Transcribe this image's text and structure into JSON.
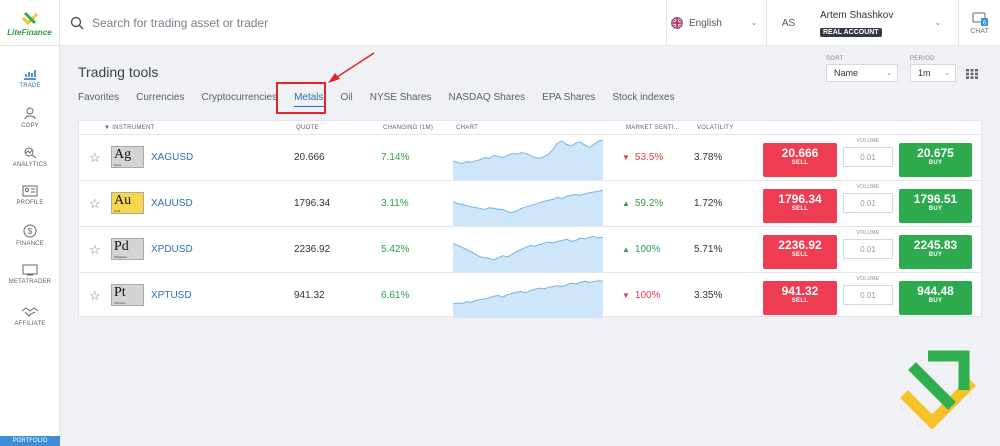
{
  "brand": {
    "name": "LiteFinance"
  },
  "search": {
    "placeholder": "Search for trading asset or trader"
  },
  "language": {
    "selected": "English"
  },
  "user": {
    "initials": "AS",
    "name": "Artem Shashkov",
    "account": "REAL ACCOUNT"
  },
  "chat": {
    "label": "CHAT",
    "badge": "6"
  },
  "sidebar": {
    "items": [
      {
        "label": "TRADE",
        "icon": "chart-icon"
      },
      {
        "label": "COPY",
        "icon": "people-icon"
      },
      {
        "label": "ANALYTICS",
        "icon": "analytics-icon"
      },
      {
        "label": "PROFILE",
        "icon": "profile-card-icon"
      },
      {
        "label": "FINANCE",
        "icon": "dollar-icon"
      },
      {
        "label": "METATRADER",
        "icon": "monitor-icon"
      },
      {
        "label": "AFFILIATE",
        "icon": "handshake-icon"
      }
    ],
    "portfolio": "PORTFOLIO"
  },
  "page": {
    "title": "Trading tools"
  },
  "tabs": [
    "Favorites",
    "Currencies",
    "Cryptocurrencies",
    "Metals",
    "Oil",
    "NYSE Shares",
    "NASDAQ Shares",
    "EPA Shares",
    "Stock indexes"
  ],
  "active_tab": "Metals",
  "controls": {
    "sort_label": "SORT",
    "sort_value": "Name",
    "period_label": "PERIOD",
    "period_value": "1m"
  },
  "table": {
    "headers": {
      "instrument": "INSTRUMENT",
      "quote": "QUOTE",
      "changing": "CHANGING (1M)",
      "chart": "CHART",
      "sentiment": "MARKET SENTI...",
      "volatility": "VOLATILITY"
    },
    "volume_label": "VOLUME",
    "sell_label": "SELL",
    "buy_label": "BUY",
    "rows": [
      {
        "tile": "Ag",
        "tile_name": "Silver",
        "symbol": "XAGUSD",
        "quote": "20.666",
        "change": "7.14%",
        "sentiment": "53.5%",
        "sentiment_dir": "down",
        "volatility": "3.78%",
        "sell": "20.666",
        "buy": "20.675",
        "volume": "0.01",
        "tile_color": "#d4d4d4",
        "spark": [
          0.42,
          0.38,
          0.35,
          0.4,
          0.38,
          0.42,
          0.45,
          0.5,
          0.48,
          0.55,
          0.52,
          0.5,
          0.55,
          0.6,
          0.58,
          0.62,
          0.6,
          0.55,
          0.5,
          0.48,
          0.52,
          0.58,
          0.7,
          0.85,
          0.9,
          0.82,
          0.78,
          0.85,
          0.88,
          0.8,
          0.75,
          0.82,
          0.9,
          0.92
        ]
      },
      {
        "tile": "Au",
        "tile_name": "Gold",
        "symbol": "XAUUSD",
        "quote": "1796.34",
        "change": "3.11%",
        "sentiment": "59.2%",
        "sentiment_dir": "up",
        "volatility": "1.72%",
        "sell": "1796.34",
        "buy": "1796.51",
        "volume": "0.01",
        "tile_color": "#f6d64a",
        "spark": [
          0.55,
          0.5,
          0.48,
          0.45,
          0.42,
          0.4,
          0.38,
          0.35,
          0.4,
          0.38,
          0.36,
          0.35,
          0.3,
          0.28,
          0.32,
          0.38,
          0.42,
          0.45,
          0.48,
          0.52,
          0.55,
          0.58,
          0.6,
          0.65,
          0.62,
          0.68,
          0.7,
          0.72,
          0.7,
          0.74,
          0.76,
          0.78,
          0.8,
          0.82
        ]
      },
      {
        "tile": "Pd",
        "tile_name": "Palladium",
        "symbol": "XPDUSD",
        "quote": "2236.92",
        "change": "5.42%",
        "sentiment": "100%",
        "sentiment_dir": "up",
        "volatility": "5.71%",
        "sell": "2236.92",
        "buy": "2245.83",
        "volume": "0.01",
        "tile_color": "#d4d4d4",
        "spark": [
          0.65,
          0.6,
          0.55,
          0.5,
          0.45,
          0.38,
          0.32,
          0.3,
          0.28,
          0.25,
          0.3,
          0.35,
          0.32,
          0.38,
          0.45,
          0.5,
          0.55,
          0.6,
          0.58,
          0.62,
          0.65,
          0.68,
          0.66,
          0.7,
          0.72,
          0.75,
          0.7,
          0.72,
          0.78,
          0.76,
          0.8,
          0.82,
          0.78,
          0.8
        ]
      },
      {
        "tile": "Pt",
        "tile_name": "Platinum",
        "symbol": "XPTUSD",
        "quote": "941.32",
        "change": "6.61%",
        "sentiment": "100%",
        "sentiment_dir": "down",
        "volatility": "3.35%",
        "sell": "941.32",
        "buy": "944.48",
        "volume": "0.01",
        "tile_color": "#d4d4d4",
        "spark": [
          0.3,
          0.32,
          0.3,
          0.35,
          0.33,
          0.38,
          0.4,
          0.42,
          0.45,
          0.48,
          0.5,
          0.46,
          0.52,
          0.55,
          0.58,
          0.6,
          0.56,
          0.62,
          0.65,
          0.68,
          0.66,
          0.7,
          0.72,
          0.74,
          0.72,
          0.76,
          0.8,
          0.78,
          0.82,
          0.85,
          0.82,
          0.84,
          0.86,
          0.85
        ]
      }
    ]
  },
  "colors": {
    "accent": "#2c6fb8",
    "sell": "#ee3d52",
    "buy": "#2daa4e",
    "positive": "#2e9e4a",
    "negative": "#e23b4d",
    "spark_fill": "#cfe6fa",
    "spark_line": "#6fb6ee",
    "highlight": "#e0282a"
  }
}
